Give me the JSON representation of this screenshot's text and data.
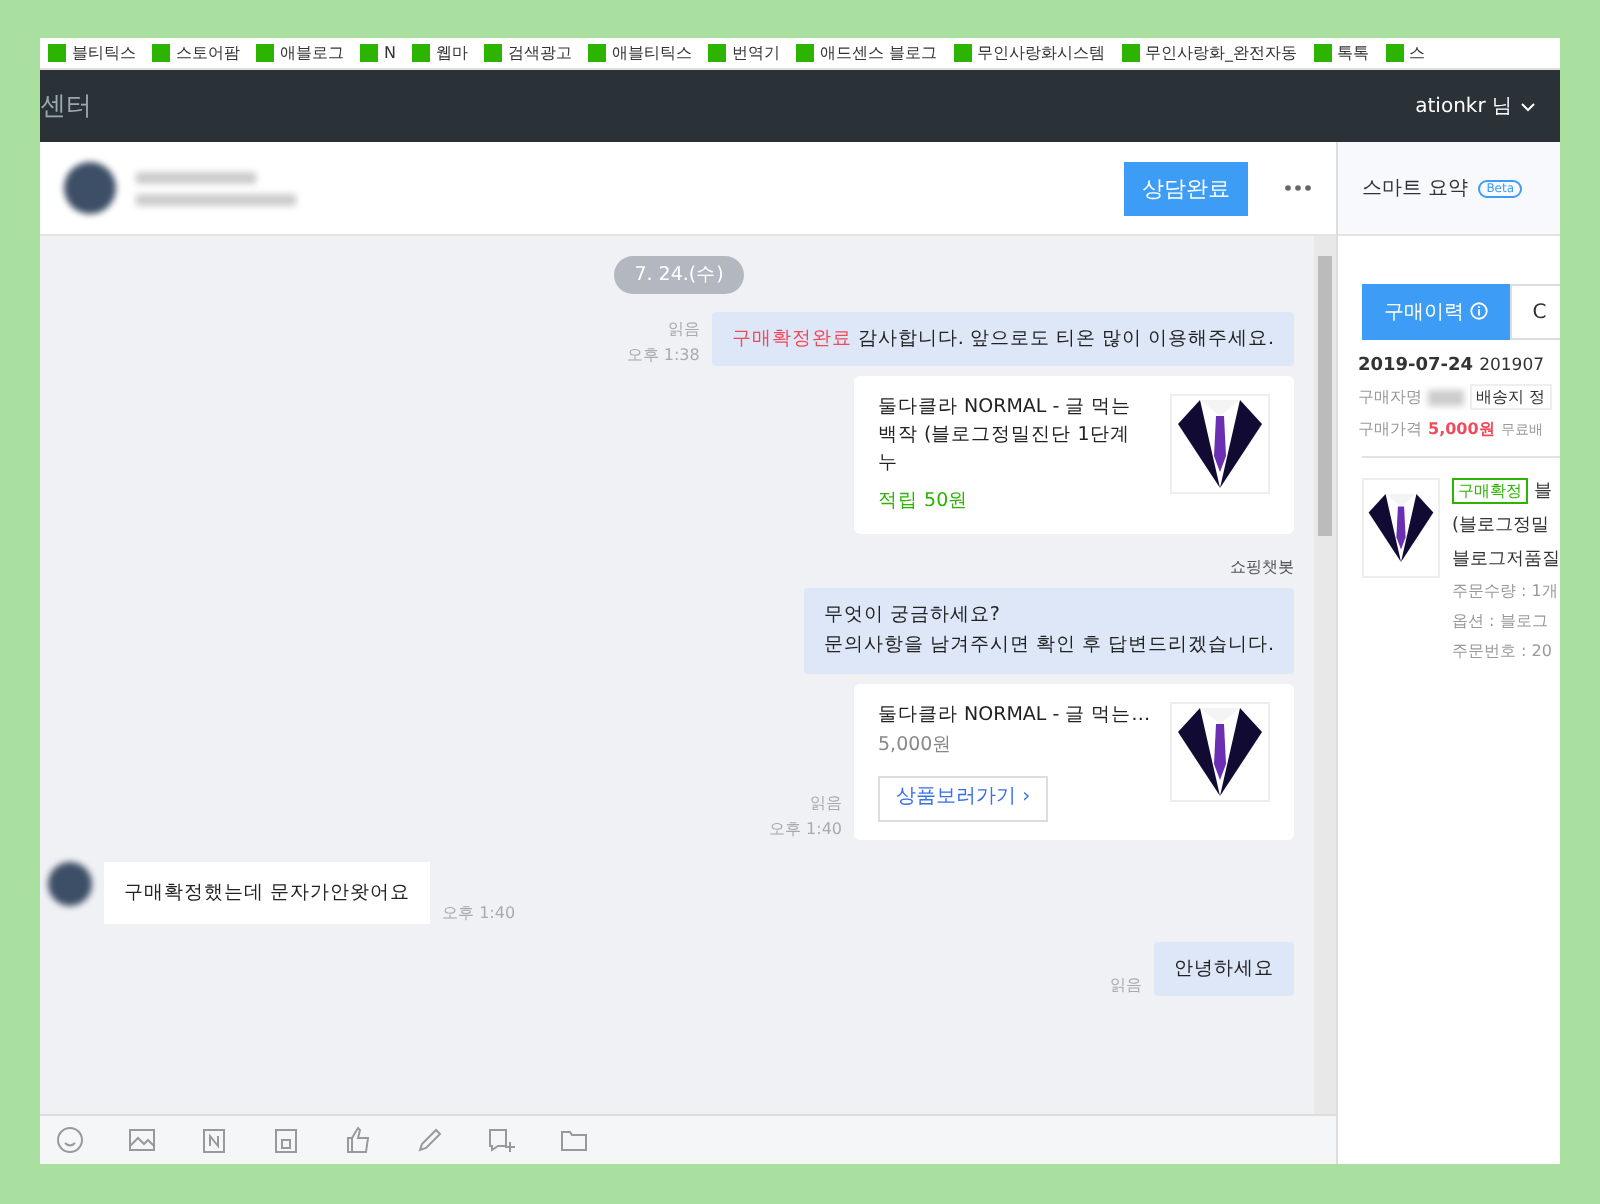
{
  "bookmarks": [
    {
      "label": "블티틱스"
    },
    {
      "label": "스토어팜"
    },
    {
      "label": "애블로그"
    },
    {
      "label": "N"
    },
    {
      "label": "웹마"
    },
    {
      "label": "검색광고"
    },
    {
      "label": "애블티틱스"
    },
    {
      "label": "번역기"
    },
    {
      "label": "애드센스 블로그"
    },
    {
      "label": "무인사랑화시스템"
    },
    {
      "label": "무인사랑화_완전자동"
    },
    {
      "label": "톡톡"
    },
    {
      "label": "스"
    }
  ],
  "topbar": {
    "title": "센터",
    "user": "ationkr 님"
  },
  "chat_header": {
    "complete_button": "상담완료"
  },
  "messages": [
    {
      "kind": "date",
      "text": "7. 24.(수)"
    },
    {
      "kind": "text_out",
      "read": "읽음",
      "time": "오후 1:38",
      "text": "**구매확정완료** 감사합니다. 앞으로도 티온 많이 이용해주세요."
    },
    {
      "kind": "product_out",
      "title": "둘다클라 NORMAL - 글 먹는 백작 (블로그정밀진단 1단계 누",
      "note": "적립 50원"
    },
    {
      "kind": "sender",
      "text": "쇼핑챗봇"
    },
    {
      "kind": "text_out",
      "text": "무엇이 궁금하세요?\n문의사항을 남겨주시면 확인 후 답변드리겠습니다."
    },
    {
      "kind": "product_out",
      "read": "읽음",
      "time": "오후 1:40",
      "title": "둘다클라 NORMAL - 글 먹는…",
      "price": "5,000원",
      "link": "상품보러가기 ›"
    },
    {
      "kind": "text_in",
      "time": "오후 1:40",
      "text": "구매확정했는데 문자가안왓어요"
    },
    {
      "kind": "text_out",
      "read": "읽음",
      "text": "안녕하세요"
    }
  ],
  "side": {
    "title": "스마트 요약",
    "badge": "Beta",
    "tabs": [
      {
        "label": "구매이력",
        "selected": true
      },
      {
        "label": "C",
        "selected": false
      }
    ],
    "date": "2019-07-24",
    "order_id": "201907",
    "buyer_label": "구매자명",
    "shipping": "배송지 정",
    "price_label": "구매가격",
    "price": "5,000원",
    "price_note": "무료배",
    "item": {
      "status": "구매확정",
      "name": "블",
      "line1": "(블로그정밀",
      "line2": "블로그저품질",
      "details": [
        "주문수량 : 1개",
        "옵션 : 블로그",
        "주문번호 : 20"
      ]
    }
  }
}
